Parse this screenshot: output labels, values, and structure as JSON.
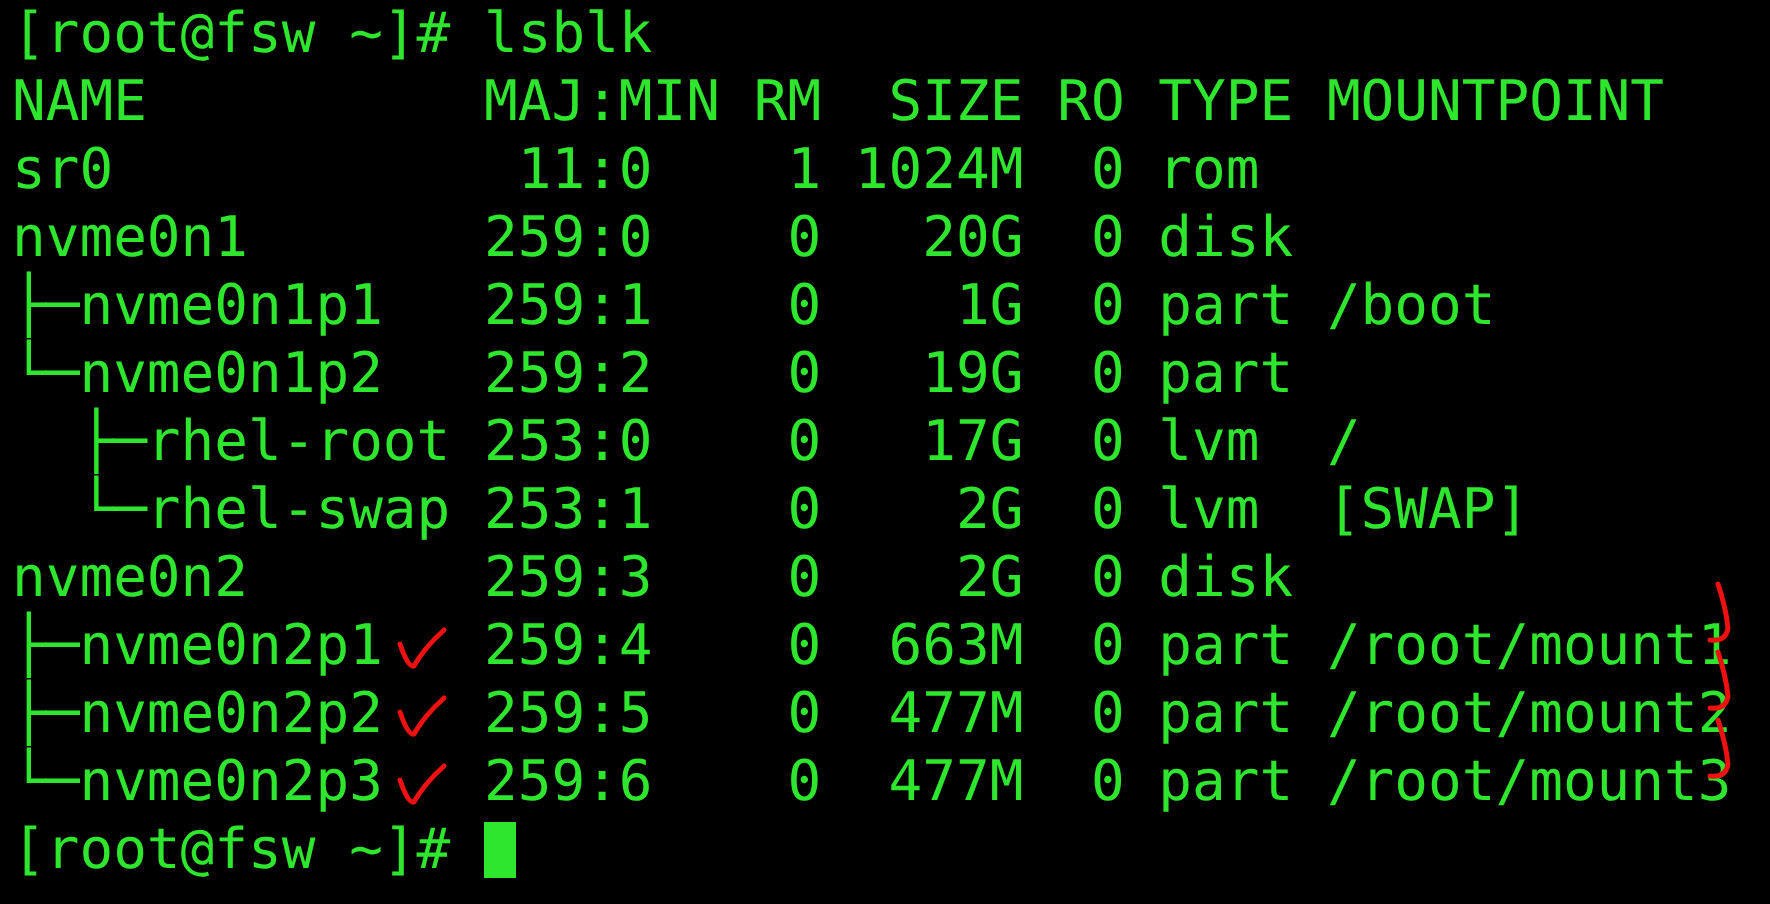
{
  "terminal": {
    "lines": [
      {
        "text": "[root@fsw ~]# lsblk"
      },
      {
        "text": "NAME          MAJ:MIN RM  SIZE RO TYPE MOUNTPOINT"
      },
      {
        "text": "sr0            11:0    1 1024M  0 rom"
      },
      {
        "text": "nvme0n1       259:0    0   20G  0 disk"
      },
      {
        "text": "├─nvme0n1p1   259:1    0    1G  0 part /boot"
      },
      {
        "text": "└─nvme0n1p2   259:2    0   19G  0 part"
      },
      {
        "text": "  ├─rhel-root 253:0    0   17G  0 lvm  /"
      },
      {
        "text": "  └─rhel-swap 253:1    0    2G  0 lvm  [SWAP]"
      },
      {
        "text": "nvme0n2       259:3    0    2G  0 disk"
      },
      {
        "text": "├─nvme0n2p1   259:4    0  663M  0 part /root/mount1",
        "tick": true,
        "end_mark": true
      },
      {
        "text": "├─nvme0n2p2   259:5    0  477M  0 part /root/mount2",
        "tick": true,
        "end_mark": true
      },
      {
        "text": "└─nvme0n2p3   259:6    0  477M  0 part /root/mount3",
        "tick": true,
        "end_mark": true
      },
      {
        "text": "[root@fsw ~]#",
        "cursor": true
      }
    ]
  }
}
